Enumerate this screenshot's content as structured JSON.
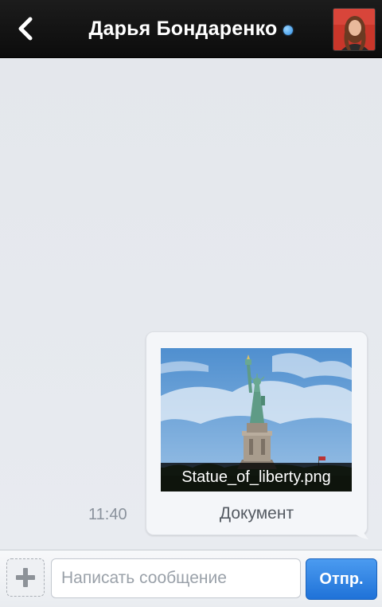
{
  "header": {
    "title": "Дарья Бондаренко",
    "online": true,
    "back_icon": "chevron-left-icon",
    "colors": {
      "background": "#141414",
      "title": "#ffffff",
      "online_dot": "#3d9cf0"
    }
  },
  "chat": {
    "messages": [
      {
        "direction": "outgoing",
        "time": "11:40",
        "attachment": {
          "type": "image",
          "filename": "Statue_of_liberty.png",
          "label": "Документ"
        }
      }
    ]
  },
  "composer": {
    "attach_icon": "plus-icon",
    "placeholder": "Написать сообщение",
    "value": "",
    "send_label": "Отпр.",
    "colors": {
      "send_button": "#2b80e0"
    }
  }
}
